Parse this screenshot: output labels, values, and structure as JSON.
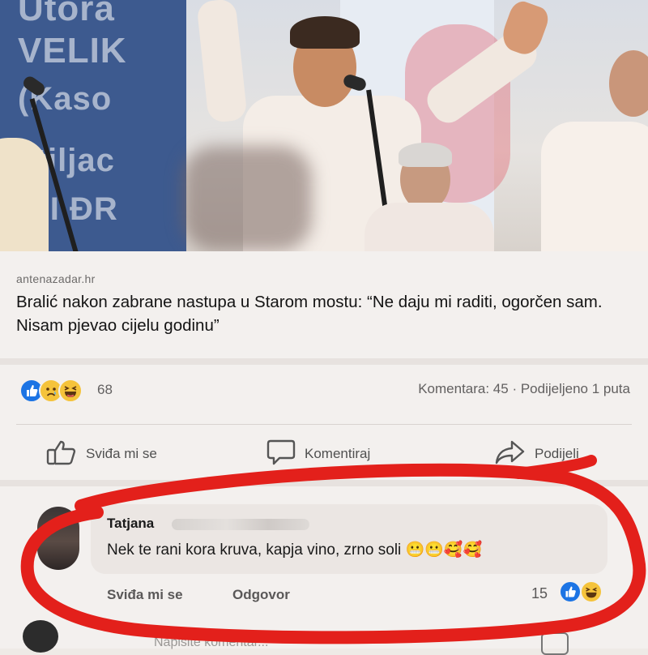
{
  "photo": {
    "banner_lines": [
      "Utora",
      "VELIK",
      "(Kaso",
      "ostiljac",
      "DNI ĐR"
    ]
  },
  "post": {
    "source": "antenazadar.hr",
    "headline": "Bralić nakon zabrane nastupa u Starom mostu: “Ne daju mi raditi, ogorčen sam. Nisam pjevao cijelu godinu”",
    "reaction_count": "68",
    "stats": "Komentara: 45 · Podijeljeno 1 puta",
    "actions": {
      "like": "Sviđa mi se",
      "comment": "Komentiraj",
      "share": "Podijeli"
    }
  },
  "comment": {
    "author": "Tatjana",
    "text": "Nek te rani kora kruva, kapja vino, zrno soli 😬😬🥰🥰",
    "like_label": "Sviđa mi se",
    "reply_label": "Odgovor",
    "reaction_count": "15"
  },
  "composer": {
    "placeholder": "Napišite komentar..."
  },
  "colors": {
    "like_blue": "#1c74e4",
    "emoji_yellow": "#f5c33b",
    "marker_red": "#e3201b"
  }
}
